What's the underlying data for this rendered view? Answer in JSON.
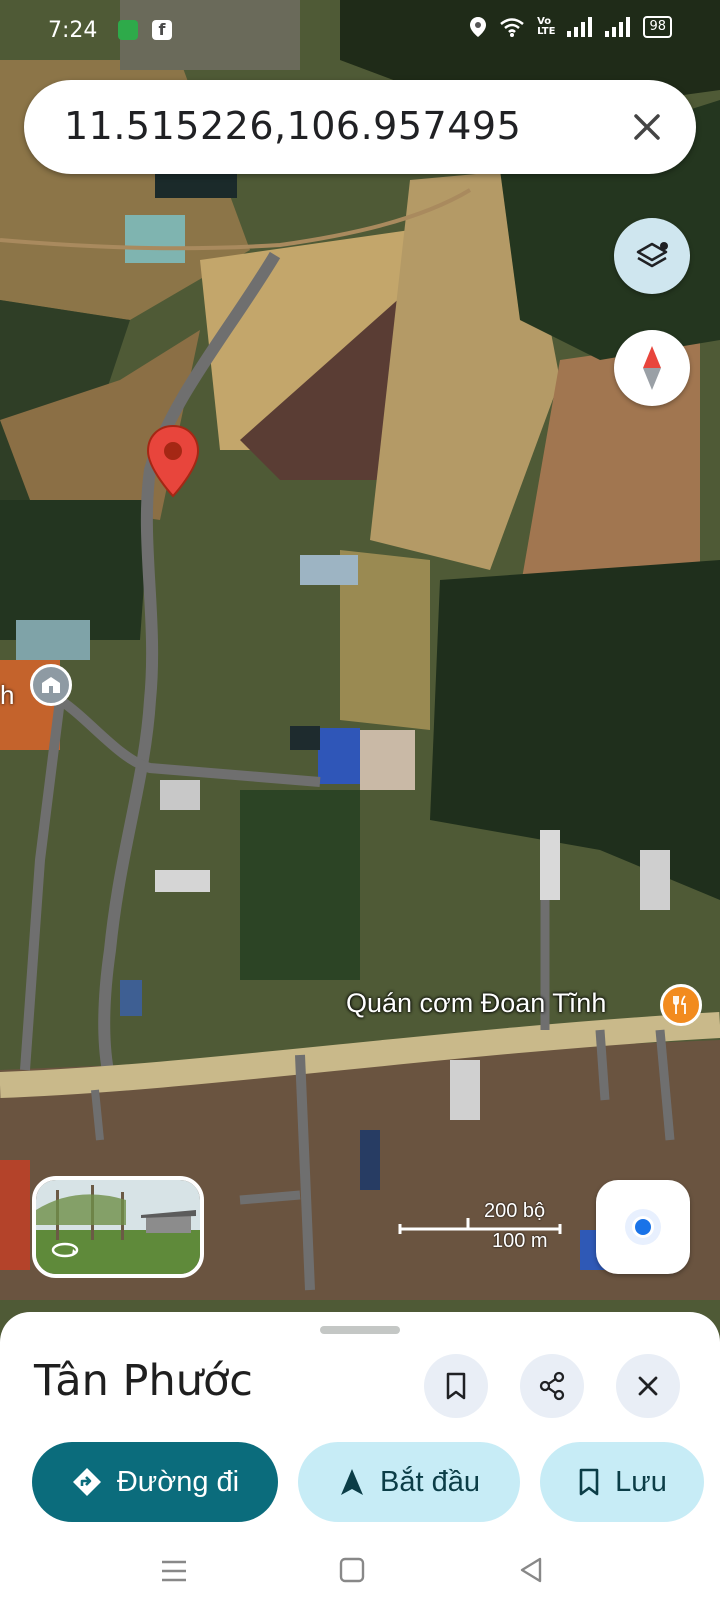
{
  "status_bar": {
    "time": "7:24",
    "battery": "98"
  },
  "search": {
    "query": "11.515226,106.957495"
  },
  "map": {
    "poi_label": "Quán cơm Đoan Tĩnh",
    "edge_label": "h",
    "scale_feet": "200 bộ",
    "scale_meters": "100 m"
  },
  "place": {
    "title": "Tân Phước",
    "actions": {
      "directions": "Đường đi",
      "start": "Bắt đầu",
      "save": "Lưu"
    }
  },
  "icons": [
    "layers-icon",
    "compass-icon",
    "location-pin-icon",
    "my-location-icon",
    "bookmark-icon",
    "share-icon",
    "close-icon",
    "directions-icon",
    "navigation-arrow-icon",
    "recents-icon",
    "home-icon",
    "back-icon"
  ],
  "colors": {
    "accent_teal": "#0b6c7c",
    "chip_light": "#c7ecf6",
    "pin_red": "#e8453c",
    "poi_orange": "#f28b1e"
  }
}
